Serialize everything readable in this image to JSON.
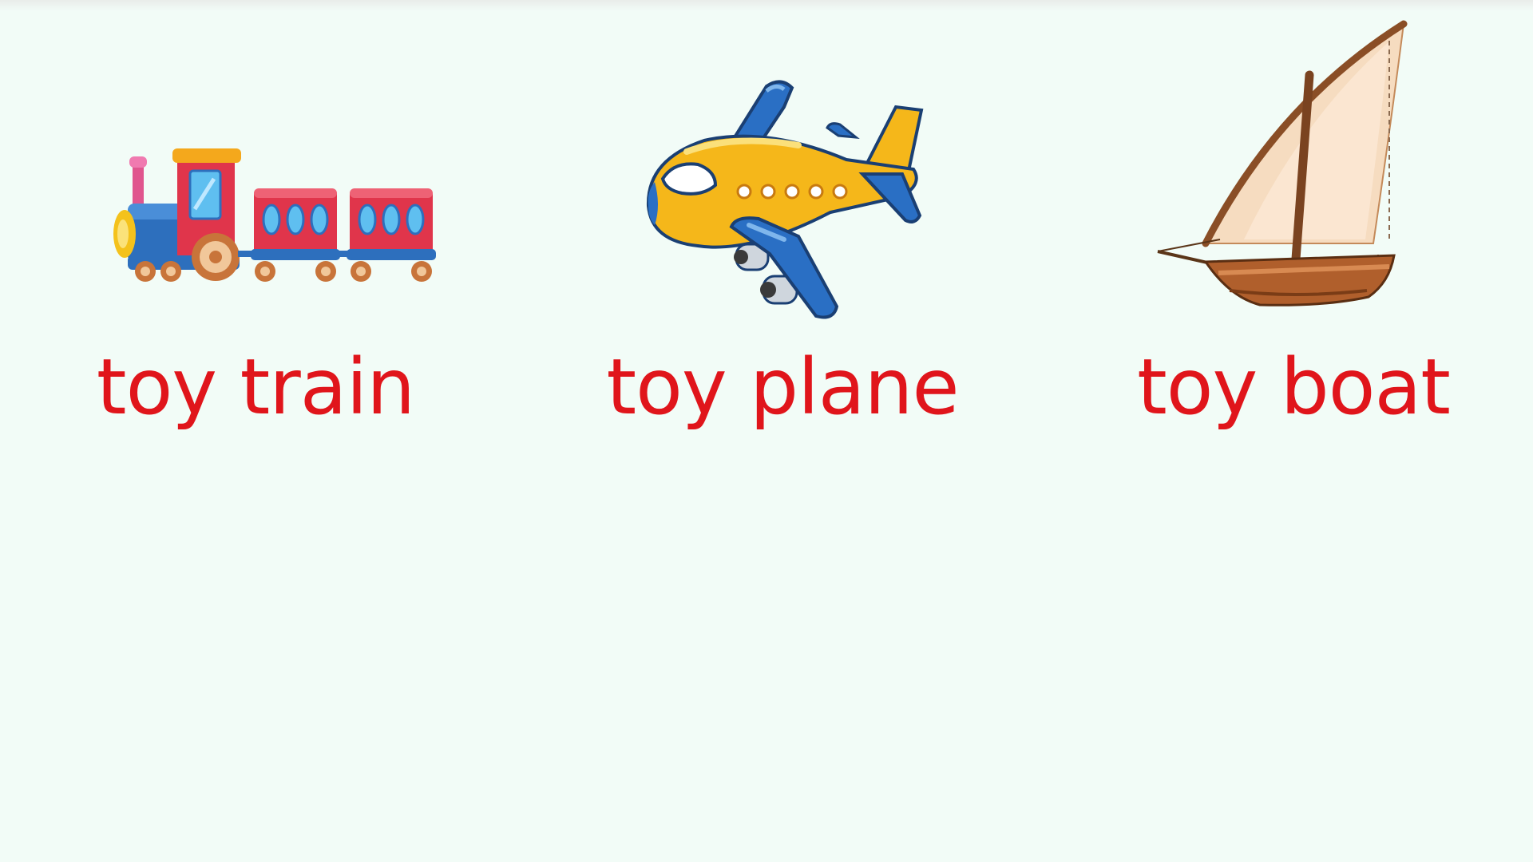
{
  "colors": {
    "background": "#f2fcf7",
    "label": "#e0151b"
  },
  "items": [
    {
      "label": "toy train",
      "icon": "toy-train-icon"
    },
    {
      "label": "toy plane",
      "icon": "toy-plane-icon"
    },
    {
      "label": "toy boat",
      "icon": "toy-boat-icon"
    }
  ]
}
